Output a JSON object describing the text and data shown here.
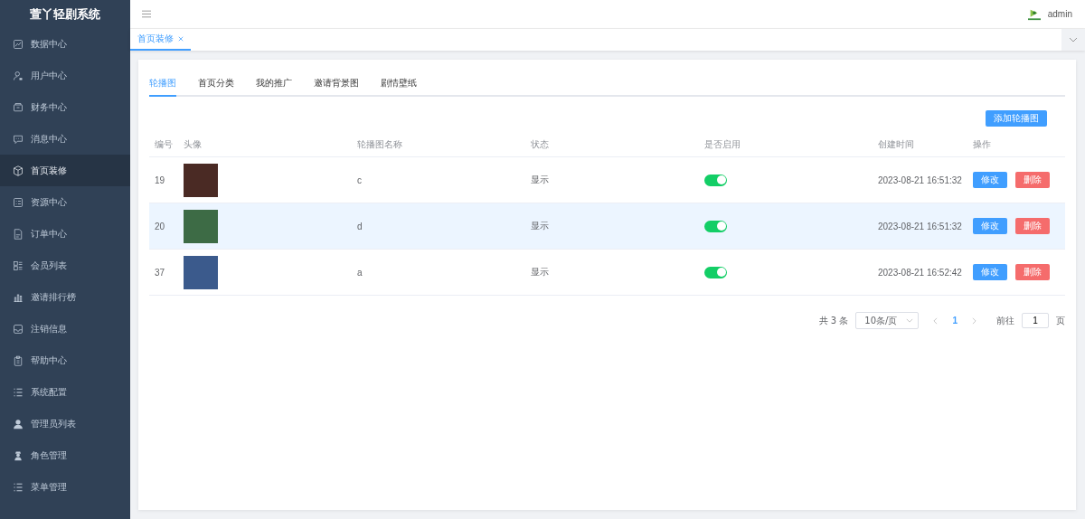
{
  "sidebar": {
    "title": "萱丫轻剧系统",
    "items": [
      {
        "label": "数据中心",
        "selected": false
      },
      {
        "label": "用户中心",
        "selected": false
      },
      {
        "label": "财务中心",
        "selected": false
      },
      {
        "label": "消息中心",
        "selected": false
      },
      {
        "label": "首页装修",
        "selected": true
      },
      {
        "label": "资源中心",
        "selected": false
      },
      {
        "label": "订单中心",
        "selected": false
      },
      {
        "label": "会员列表",
        "selected": false
      },
      {
        "label": "邀请排行榜",
        "selected": false
      },
      {
        "label": "注销信息",
        "selected": false
      },
      {
        "label": "帮助中心",
        "selected": false
      },
      {
        "label": "系统配置",
        "selected": false
      },
      {
        "label": "管理员列表",
        "selected": false
      },
      {
        "label": "角色管理",
        "selected": false
      },
      {
        "label": "菜单管理",
        "selected": false
      }
    ]
  },
  "header": {
    "user": "admin"
  },
  "page_tabs": [
    {
      "label": "首页装修",
      "selected": true
    }
  ],
  "tabs": [
    {
      "label": "轮播图",
      "selected": true
    },
    {
      "label": "首页分类",
      "selected": false
    },
    {
      "label": "我的推广",
      "selected": false
    },
    {
      "label": "邀请背景图",
      "selected": false
    },
    {
      "label": "剧情壁纸",
      "selected": false
    }
  ],
  "add_button": "添加轮播图",
  "table": {
    "columns": [
      "编号",
      "头像",
      "轮播图名称",
      "状态",
      "是否启用",
      "创建时间",
      "操作"
    ],
    "rows": [
      {
        "id": "19",
        "name": "c",
        "status": "显示",
        "on": true,
        "created": "2023-08-21 16:51:32",
        "edit": "修改",
        "delete": "删除",
        "selected": false
      },
      {
        "id": "20",
        "name": "d",
        "status": "显示",
        "on": true,
        "created": "2023-08-21 16:51:32",
        "edit": "修改",
        "delete": "删除",
        "selected": true
      },
      {
        "id": "37",
        "name": "a",
        "status": "显示",
        "on": true,
        "created": "2023-08-21 16:52:42",
        "edit": "修改",
        "delete": "删除",
        "selected": false
      }
    ]
  },
  "pagination": {
    "total": "共 3 条",
    "page_size": "10条/页",
    "pages": [
      {
        "label": "1",
        "selected": true
      }
    ],
    "goto_label": "前往",
    "goto_value": "1",
    "goto_suffix": "页"
  }
}
